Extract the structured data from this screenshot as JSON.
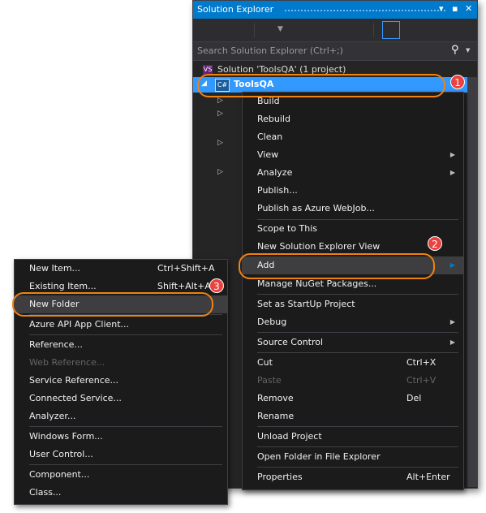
{
  "solution_explorer": {
    "title": "Solution Explorer",
    "title_buttons": [
      "▾",
      "▪",
      "✕"
    ],
    "search_placeholder": "Search Solution Explorer (Ctrl+;)",
    "solution_label": "Solution 'ToolsQA' (1 project)",
    "project_label": "ToolsQA",
    "project_icon_text": "C#",
    "solution_icon_text": "VS"
  },
  "context_menu": {
    "items": [
      {
        "label": "Build"
      },
      {
        "label": "Rebuild"
      },
      {
        "label": "Clean"
      },
      {
        "label": "View",
        "submenu": true
      },
      {
        "label": "Analyze",
        "submenu": true
      },
      {
        "label": "Publish..."
      },
      {
        "label": "Publish as Azure WebJob..."
      },
      {
        "label": "Scope to This"
      },
      {
        "label": "New Solution Explorer View"
      },
      {
        "label": "Add",
        "submenu": true,
        "highlighted": true
      },
      {
        "label": "Manage NuGet Packages..."
      },
      {
        "label": "Set as StartUp Project"
      },
      {
        "label": "Debug",
        "submenu": true
      },
      {
        "label": "Source Control",
        "submenu": true
      },
      {
        "label": "Cut",
        "shortcut": "Ctrl+X"
      },
      {
        "label": "Paste",
        "shortcut": "Ctrl+V",
        "disabled": true
      },
      {
        "label": "Remove",
        "shortcut": "Del"
      },
      {
        "label": "Rename"
      },
      {
        "label": "Unload Project"
      },
      {
        "label": "Open Folder in File Explorer"
      },
      {
        "label": "Properties",
        "shortcut": "Alt+Enter"
      }
    ]
  },
  "add_submenu": {
    "items": [
      {
        "label": "New Item...",
        "shortcut": "Ctrl+Shift+A"
      },
      {
        "label": "Existing Item...",
        "shortcut": "Shift+Alt+A"
      },
      {
        "label": "New Folder",
        "highlighted": true
      },
      {
        "label": "Azure API App Client..."
      },
      {
        "label": "Reference..."
      },
      {
        "label": "Web Reference...",
        "disabled": true
      },
      {
        "label": "Service Reference..."
      },
      {
        "label": "Connected Service..."
      },
      {
        "label": "Analyzer..."
      },
      {
        "label": "Windows Form..."
      },
      {
        "label": "User Control..."
      },
      {
        "label": "Component..."
      },
      {
        "label": "Class..."
      }
    ]
  },
  "annotations": {
    "badges": [
      "1",
      "2",
      "3"
    ],
    "ring_color": "#f0820e",
    "badge_color": "#e8433f"
  },
  "colors": {
    "accent": "#007acc",
    "selection": "#3399ff",
    "menu_bg": "#1b1b1c"
  }
}
